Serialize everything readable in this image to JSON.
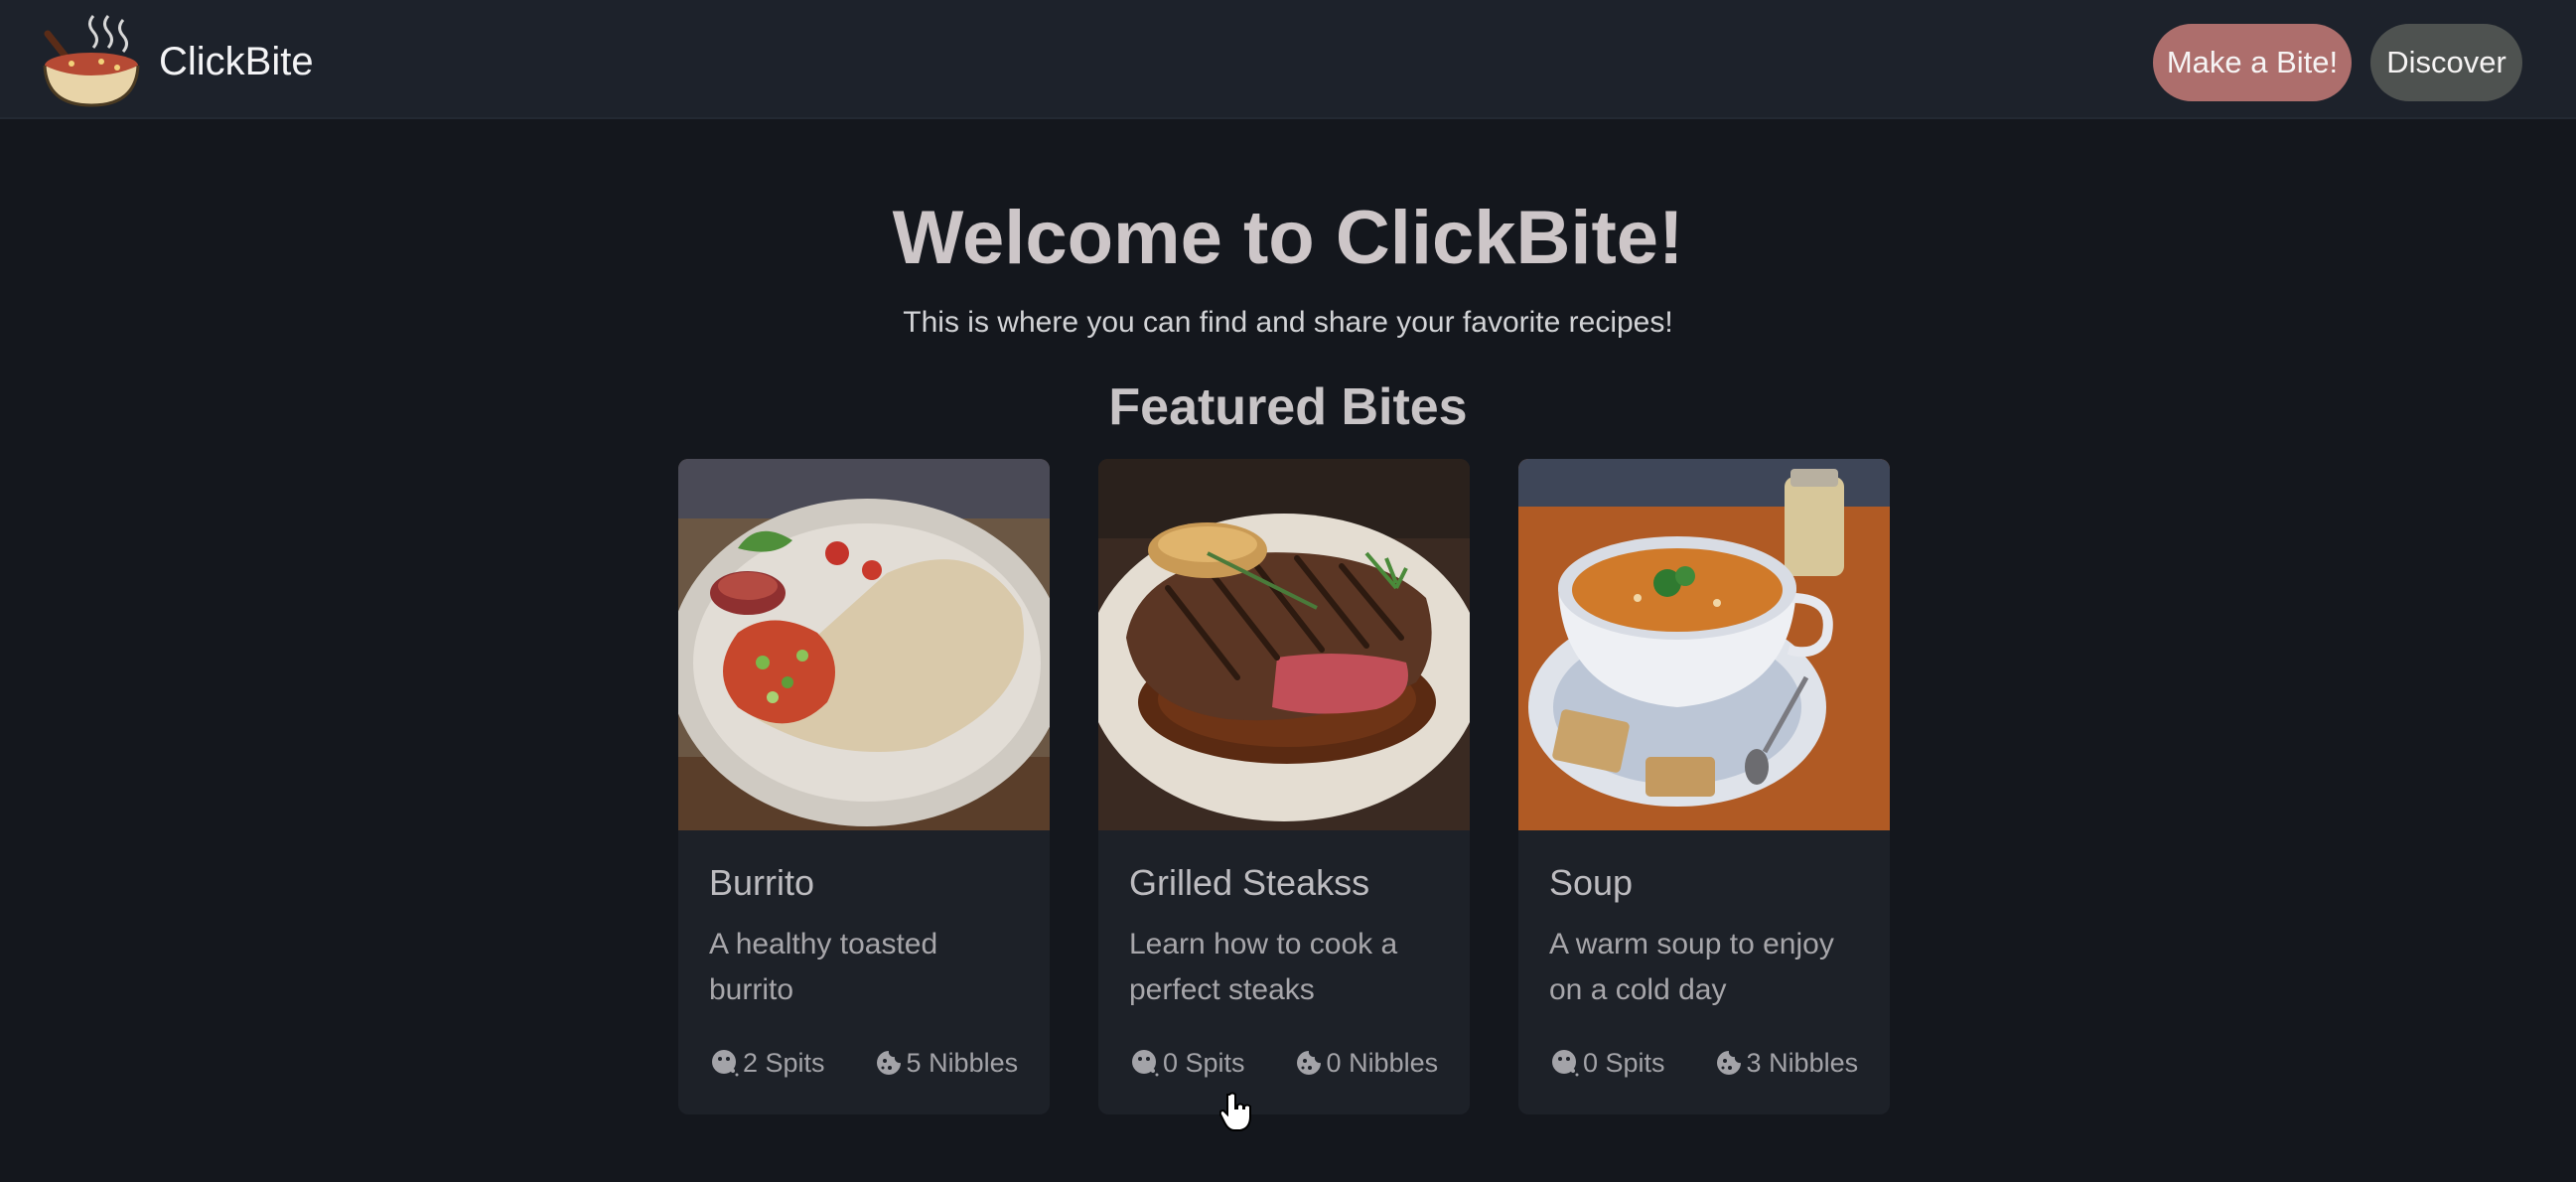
{
  "navbar": {
    "brand": "ClickBite",
    "buttons": {
      "make_label": "Make a Bite!",
      "discover_label": "Discover"
    }
  },
  "hero": {
    "title": "Welcome to ClickBite!",
    "subtitle": "This is where you can find and share your favorite recipes!"
  },
  "featured": {
    "title": "Featured Bites",
    "cards": [
      {
        "title": "Burrito",
        "desc": "A healthy toasted burrito",
        "spits": "2 Spits",
        "nibbles": "5 Nibbles"
      },
      {
        "title": "Grilled Steakss",
        "desc": "Learn how to cook a perfect steaks",
        "spits": "0 Spits",
        "nibbles": "0 Nibbles"
      },
      {
        "title": "Soup",
        "desc": "A warm soup to enjoy on a cold day",
        "spits": "0 Spits",
        "nibbles": "3 Nibbles"
      }
    ]
  },
  "icons": {
    "logo": "soup-bowl-logo-icon",
    "spits": "spit-face-icon",
    "nibbles": "cookie-icon",
    "cursor": "hand-pointer-icon"
  },
  "colors": {
    "background": "#14171d",
    "navbar": "#1d222b",
    "card": "#1d2128",
    "make_button": "#ad6e6c",
    "discover_button": "#4e5250"
  }
}
